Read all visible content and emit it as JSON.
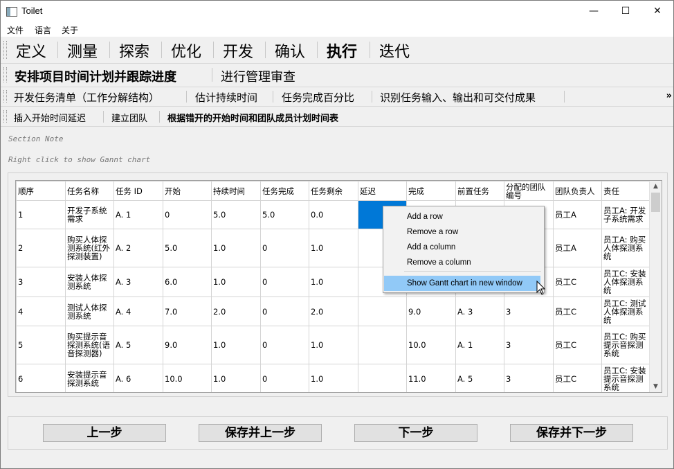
{
  "window": {
    "title": "Toilet",
    "minimize": "—",
    "maximize": "☐",
    "close": "✕"
  },
  "menu": [
    "文件",
    "语言",
    "关于"
  ],
  "phases": [
    "定义",
    "测量",
    "探索",
    "优化",
    "开发",
    "确认",
    "执行",
    "迭代"
  ],
  "activePhase": "执行",
  "steps": [
    "安排项目时间计划并跟踪进度",
    "进行管理审查"
  ],
  "tasks": [
    "开发任务清单（工作分解结构）",
    "估计持续时间",
    "任务完成百分比",
    "识别任务输入、输出和可交付成果"
  ],
  "overflow": "»",
  "subtasks": [
    "插入开始时间延迟",
    "建立团队",
    "根据错开的开始时间和团队成员计划时间表"
  ],
  "notes": {
    "section": "Section Note",
    "hint": "Right click to show Gannt chart"
  },
  "table": {
    "headers": [
      "顺序",
      "任务名称",
      "任务 ID",
      "开始",
      "持续时间",
      "任务完成",
      "任务剩余",
      "延迟",
      "完成",
      "前置任务",
      "分配的团队编号",
      "团队负责人",
      "责任"
    ],
    "rows": [
      [
        "1",
        "开发子系统需求",
        "A. 1",
        "0",
        "5.0",
        "5.0",
        "0.0",
        "",
        "",
        "",
        "",
        "员工A",
        "员工A: 开发子系统需求"
      ],
      [
        "2",
        "购买人体探测系统(红外探测装置)",
        "A. 2",
        "5.0",
        "1.0",
        "0",
        "1.0",
        "",
        "",
        "",
        "",
        "员工A",
        "员工A: 购买人体探测系统"
      ],
      [
        "3",
        "安装人体探测系统",
        "A. 3",
        "6.0",
        "1.0",
        "0",
        "1.0",
        "",
        "",
        "",
        "",
        "员工C",
        "员工C: 安装人体探测系统"
      ],
      [
        "4",
        "测试人体探测系统",
        "A. 4",
        "7.0",
        "2.0",
        "0",
        "2.0",
        "",
        "9.0",
        "A. 3",
        "3",
        "员工C",
        "员工C: 测试人体探测系统"
      ],
      [
        "5",
        "购买提示音探测系统(语音探测器)",
        "A. 5",
        "9.0",
        "1.0",
        "0",
        "1.0",
        "",
        "10.0",
        "A. 1",
        "3",
        "员工C",
        "员工C: 购买提示音探测系统"
      ],
      [
        "6",
        "安装提示音探测系统",
        "A. 6",
        "10.0",
        "1.0",
        "0",
        "1.0",
        "",
        "11.0",
        "A. 5",
        "3",
        "员工C",
        "员工C: 安装提示音探测系统"
      ]
    ]
  },
  "contextMenu": [
    "Add a row",
    "Remove a row",
    "Add a column",
    "Remove a column",
    "Show Gantt chart in new window"
  ],
  "buttons": {
    "prev": "上一步",
    "savePrev": "保存并上一步",
    "next": "下一步",
    "saveNext": "保存并下一步"
  }
}
